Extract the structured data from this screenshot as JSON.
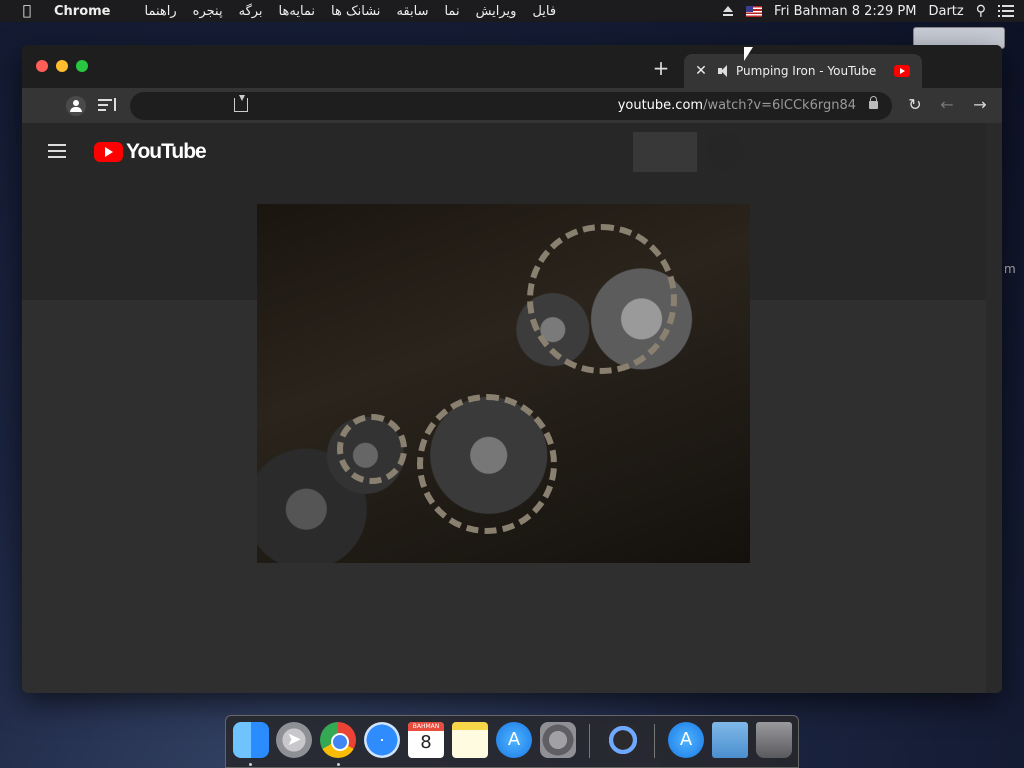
{
  "menubar": {
    "apple_icon": "apple-icon",
    "app_name": "Chrome",
    "menus": [
      "فایل",
      "ویرایش",
      "نما",
      "سابقه",
      "نشانک ها",
      "نمایه‌ها",
      "برگه",
      "پنجره",
      "راهنما"
    ],
    "clock": "Fri Bahman 8  2:29 PM",
    "user": "Dartz"
  },
  "browser": {
    "tab_title": "Pumping Iron - YouTube",
    "url_host": "youtube.com",
    "url_path": "/watch?v=6lCCk6rgn84"
  },
  "youtube": {
    "logo_text": "YouTube",
    "brand_color": "#ff0000"
  },
  "dock": {
    "calendar_month": "BAHMAN",
    "calendar_day": "8",
    "apps": [
      "Finder",
      "Launchpad",
      "Chrome",
      "Safari",
      "Calendar",
      "Notes",
      "App Store",
      "System Preferences",
      "QuickTime Player",
      "App Store",
      "Downloads",
      "Trash"
    ]
  },
  "desktop": {
    "edge_text": "m"
  }
}
